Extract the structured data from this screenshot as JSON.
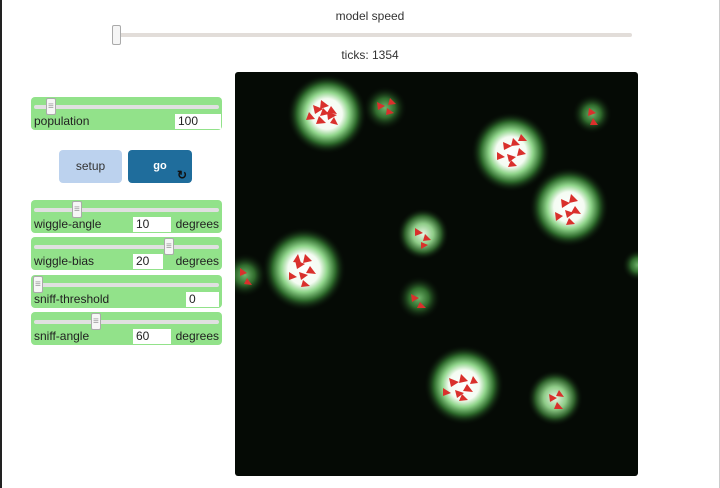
{
  "model_speed": {
    "label": "model speed",
    "value": 0
  },
  "ticks": {
    "text": "ticks: 1354"
  },
  "population": {
    "name": "population",
    "value": "100"
  },
  "buttons": {
    "setup": "setup",
    "go": "go",
    "go_icon": "refresh-icon"
  },
  "wiggle_angle": {
    "name": "wiggle-angle",
    "value": "10",
    "units": "degrees"
  },
  "wiggle_bias": {
    "name": "wiggle-bias",
    "value": "20",
    "units": "degrees"
  },
  "sniff_threshold": {
    "name": "sniff-threshold",
    "value": "0"
  },
  "sniff_angle": {
    "name": "sniff-angle",
    "value": "60",
    "units": "degrees"
  },
  "colors": {
    "slider_bg": "#92e28a",
    "setup_bg": "#bcd2ee",
    "go_bg": "#1f6d9c",
    "turtle": "#d9302c",
    "world_bg": "#050a05"
  }
}
